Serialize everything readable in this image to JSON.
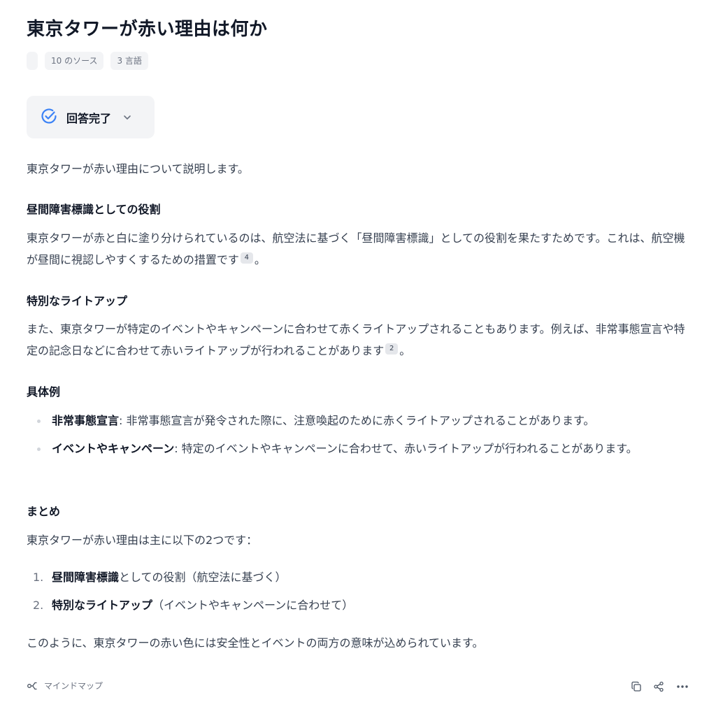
{
  "header": {
    "title": "東京タワーが赤い理由は何か",
    "chips": [
      "",
      "10 のソース",
      "3 言語"
    ]
  },
  "status": {
    "label": "回答完了"
  },
  "answer": {
    "intro": "東京タワーが赤い理由について説明します。",
    "sections": [
      {
        "heading": "昼間障害標識としての役割",
        "text": "東京タワーが赤と白に塗り分けられているのは、航空法に基づく「昼間障害標識」としての役割を果たすためです。これは、航空機が昼間に視認しやすくするための措置です",
        "citation": "4",
        "tail": "。"
      },
      {
        "heading": "特別なライトアップ",
        "text": "また、東京タワーが特定のイベントやキャンペーンに合わせて赤くライトアップされることもあります。例えば、非常事態宣言や特定の記念日などに合わせて赤いライトアップが行われることがあります",
        "citation": "2",
        "tail": "。"
      }
    ],
    "examples": {
      "heading": "具体例",
      "items": [
        {
          "bold": "非常事態宣言",
          "text": ": 非常事態宣言が発令された際に、注意喚起のために赤くライトアップされることがあります。"
        },
        {
          "bold": "イベントやキャンペーン",
          "text": ": 特定のイベントやキャンペーンに合わせて、赤いライトアップが行われることがあります。"
        }
      ]
    },
    "summary": {
      "heading": "まとめ",
      "intro": "東京タワーが赤い理由は主に以下の2つです：",
      "items": [
        {
          "num": "1.",
          "bold": "昼間障害標識",
          "text": "としての役割（航空法に基づく）"
        },
        {
          "num": "2.",
          "bold": "特別なライトアップ",
          "text": "（イベントやキャンペーンに合わせて）"
        }
      ],
      "conclusion": "このように、東京タワーの赤い色には安全性とイベントの両方の意味が込められています。"
    }
  },
  "footer": {
    "mindmap_label": "マインドマップ",
    "actions": [
      "copy-icon",
      "share-icon",
      "more-icon"
    ]
  },
  "colors": {
    "accent": "#3b82f6",
    "chip_bg": "#f3f4f6",
    "heading": "#111827",
    "body": "#374151"
  }
}
